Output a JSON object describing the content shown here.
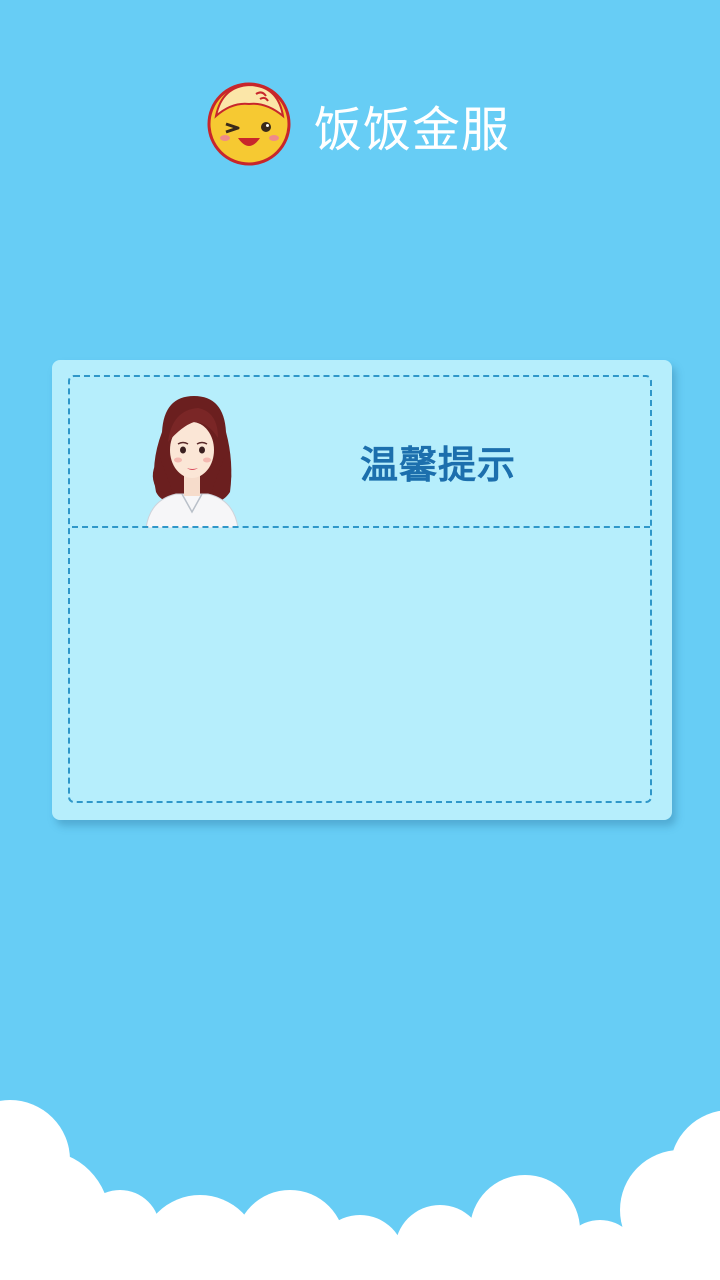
{
  "header": {
    "app_title": "饭饭金服",
    "logo_icon": "mascot-logo-icon"
  },
  "dialog": {
    "title": "温馨提示",
    "avatar_icon": "woman-avatar-icon",
    "message": ""
  },
  "colors": {
    "background": "#67cdf5",
    "card": "#b6eefc",
    "dashed_border": "#2f97c9",
    "title_text": "#1c6fad",
    "clouds": "#ffffff"
  }
}
